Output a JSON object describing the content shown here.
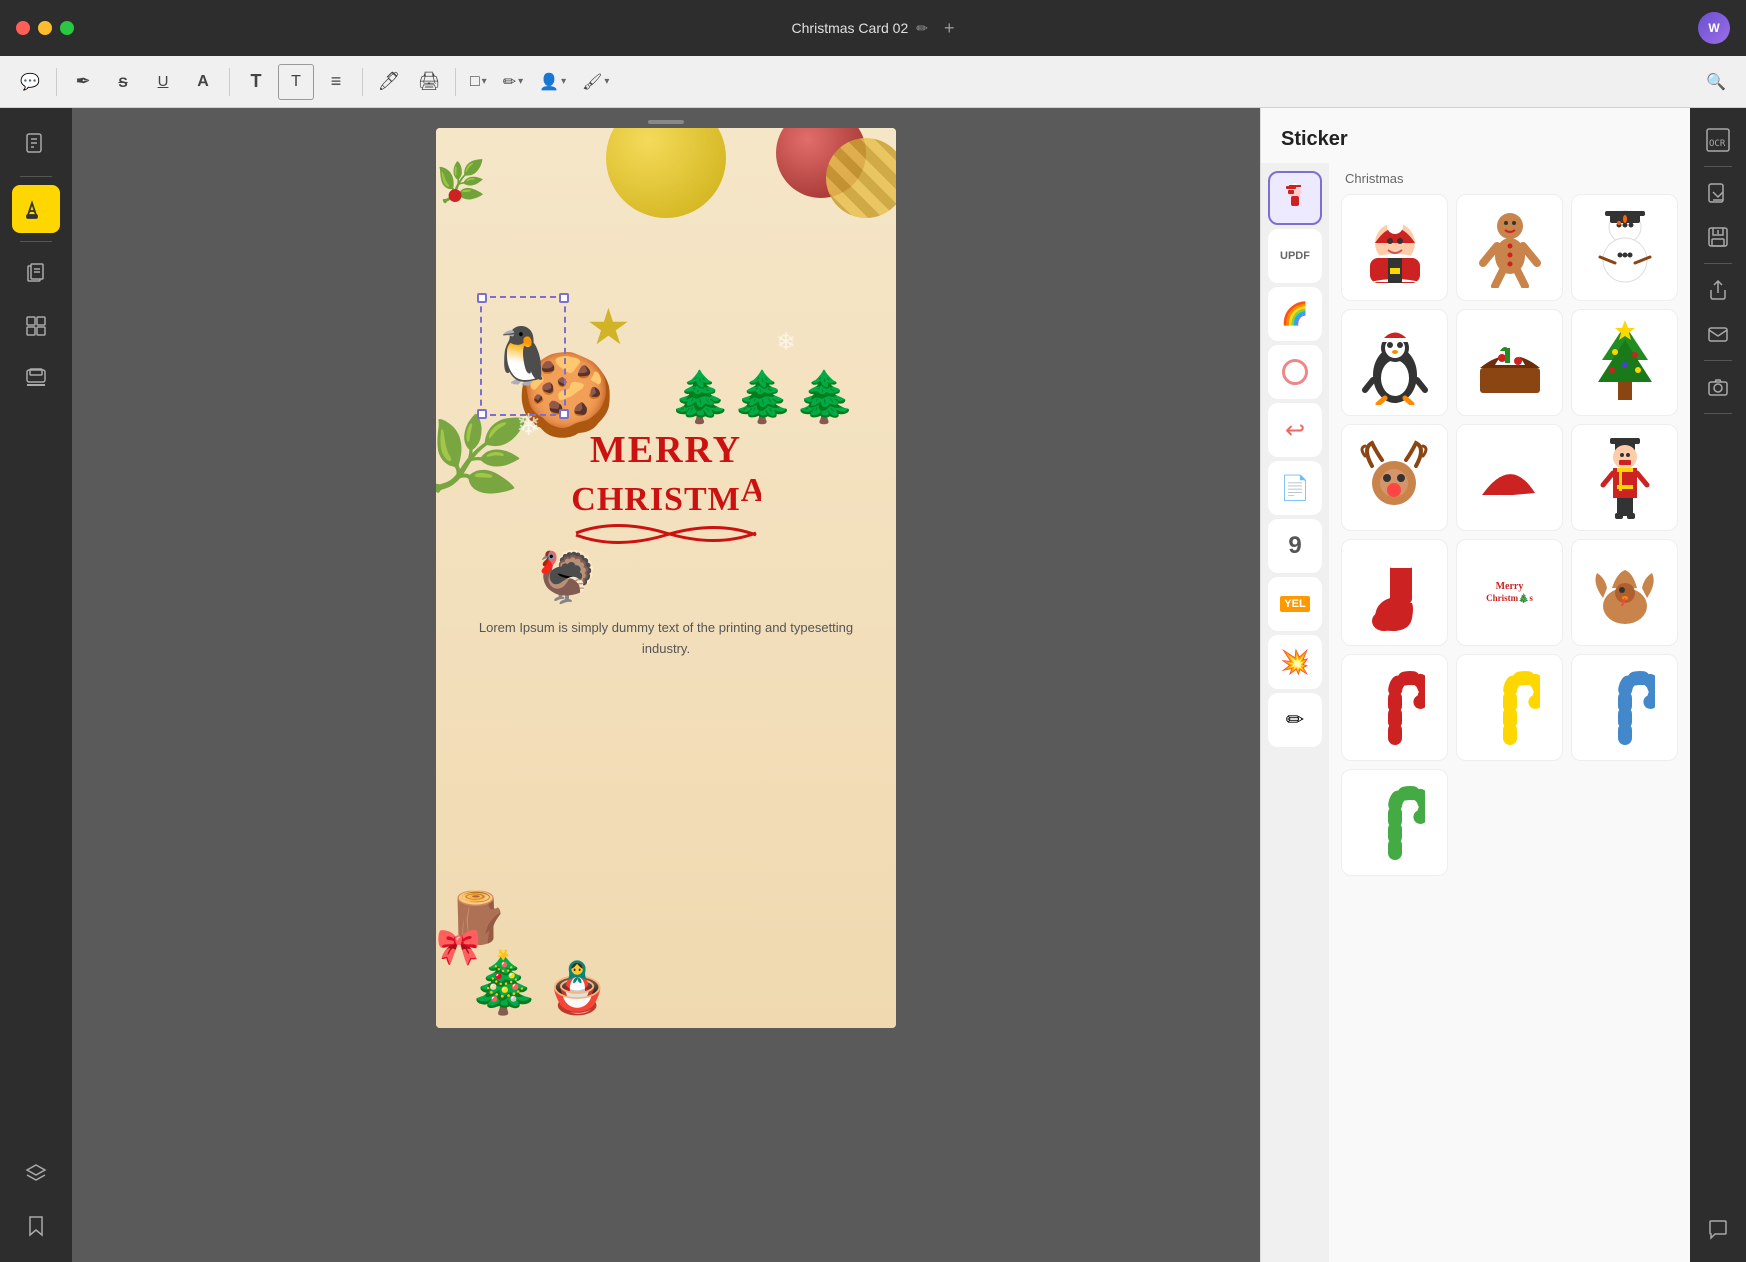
{
  "titleBar": {
    "title": "Christmas Card 02",
    "editIcon": "✏",
    "addIcon": "+",
    "avatar": "W"
  },
  "toolbar": {
    "buttons": [
      {
        "name": "comment-btn",
        "icon": "💬",
        "label": "Comment"
      },
      {
        "name": "pen-btn",
        "icon": "✒",
        "label": "Pen"
      },
      {
        "name": "strikethrough-btn",
        "icon": "S̶",
        "label": "Strikethrough"
      },
      {
        "name": "underline-btn",
        "icon": "U̲",
        "label": "Underline"
      },
      {
        "name": "text-btn",
        "icon": "A",
        "label": "Text"
      },
      {
        "name": "text2-btn",
        "icon": "T",
        "label": "Text2"
      },
      {
        "name": "text3-btn",
        "icon": "T̲",
        "label": "Text3"
      },
      {
        "name": "list-btn",
        "icon": "≡",
        "label": "List"
      },
      {
        "name": "stamp-btn",
        "icon": "✒",
        "label": "Stamp"
      },
      {
        "name": "shape-btn",
        "icon": "□",
        "label": "Shape"
      },
      {
        "name": "edit-btn",
        "icon": "✏",
        "label": "Edit"
      },
      {
        "name": "person-btn",
        "icon": "👤",
        "label": "Person"
      },
      {
        "name": "brush-btn",
        "icon": "🖌",
        "label": "Brush"
      },
      {
        "name": "search-btn",
        "icon": "🔍",
        "label": "Search"
      }
    ]
  },
  "leftSidebar": {
    "buttons": [
      {
        "name": "document-btn",
        "icon": "📋",
        "label": "Document"
      },
      {
        "name": "highlight-btn",
        "icon": "🖊",
        "label": "Highlight",
        "active": true
      },
      {
        "name": "pages-btn",
        "icon": "📄",
        "label": "Pages"
      },
      {
        "name": "organize-btn",
        "icon": "🗂",
        "label": "Organize"
      },
      {
        "name": "stamp2-btn",
        "icon": "🔖",
        "label": "Stamp"
      },
      {
        "name": "layers-btn",
        "icon": "⬡",
        "label": "Layers"
      },
      {
        "name": "bookmark-btn",
        "icon": "🔖",
        "label": "Bookmark"
      }
    ]
  },
  "stickerPanel": {
    "title": "Sticker",
    "categories": [
      {
        "name": "christmas-cat",
        "icon": "🎅",
        "label": "Christmas",
        "active": true
      },
      {
        "name": "updf-cat",
        "icon": "📝",
        "label": "UPDF"
      },
      {
        "name": "emoji-cat",
        "icon": "🌈",
        "label": "Emoji"
      },
      {
        "name": "shapes-cat",
        "icon": "⭕",
        "label": "Shapes"
      },
      {
        "name": "arrows-cat",
        "icon": "↩",
        "label": "Arrows"
      },
      {
        "name": "paper-cat",
        "icon": "📄",
        "label": "Paper"
      },
      {
        "name": "numbers-cat",
        "icon": "9",
        "label": "Numbers"
      },
      {
        "name": "labels-cat",
        "icon": "🏷",
        "label": "Labels"
      },
      {
        "name": "burst-cat",
        "icon": "💥",
        "label": "Burst"
      },
      {
        "name": "pencil-cat",
        "icon": "✏",
        "label": "Pencil"
      }
    ],
    "activeCategory": "Christmas",
    "stickers": [
      {
        "name": "santa",
        "emoji": "🎅",
        "label": "Santa Claus"
      },
      {
        "name": "gingerbread",
        "emoji": "🍪",
        "label": "Gingerbread Man"
      },
      {
        "name": "snowman",
        "emoji": "⛄",
        "label": "Snowman"
      },
      {
        "name": "penguin",
        "emoji": "🐧",
        "label": "Penguin with hat"
      },
      {
        "name": "christmas-pudding",
        "emoji": "🎂",
        "label": "Christmas Pudding"
      },
      {
        "name": "christmas-tree",
        "emoji": "🎄",
        "label": "Christmas Tree"
      },
      {
        "name": "reindeer",
        "emoji": "🦌",
        "label": "Reindeer"
      },
      {
        "name": "santa-hat",
        "emoji": "🎩",
        "label": "Santa Hat"
      },
      {
        "name": "nutcracker",
        "emoji": "🪆",
        "label": "Nutcracker"
      },
      {
        "name": "stocking",
        "emoji": "🧦",
        "label": "Christmas Stocking"
      },
      {
        "name": "merry-christmas-text",
        "emoji": "📝",
        "label": "Merry Christmas Text"
      },
      {
        "name": "turkey",
        "emoji": "🦃",
        "label": "Turkey"
      },
      {
        "name": "candy-cane-red",
        "emoji": "🍭",
        "label": "Red Candy Cane"
      },
      {
        "name": "candy-cane-yellow",
        "emoji": "🍬",
        "label": "Yellow Candy Cane"
      },
      {
        "name": "candy-cane-blue",
        "emoji": "🍭",
        "label": "Blue Candy Cane"
      },
      {
        "name": "candy-cane-green",
        "emoji": "🍭",
        "label": "Green Candy Cane"
      }
    ]
  },
  "canvas": {
    "cardTitle": "Christmas Card 02",
    "merryChristmas": "MERRY\nCHRISTMAS",
    "loremText": "Lorem Ipsum is simply dummy text of the printing and typesetting industry.",
    "selectedSticker": "🐧"
  },
  "rightSidebar": {
    "buttons": [
      {
        "name": "ocr-btn",
        "label": "OCR"
      },
      {
        "name": "extract-btn",
        "icon": "📤"
      },
      {
        "name": "save-btn",
        "icon": "💾"
      },
      {
        "name": "share-btn",
        "icon": "📤"
      },
      {
        "name": "camera-btn",
        "icon": "📷"
      },
      {
        "name": "chat-btn",
        "icon": "💬"
      }
    ]
  }
}
